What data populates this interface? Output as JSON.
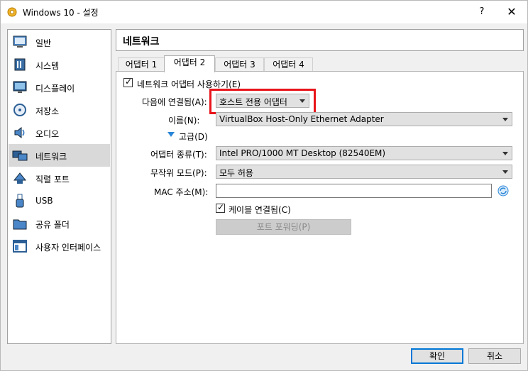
{
  "window": {
    "title": "Windows 10 - 설정",
    "help_label": "?",
    "close_label": "✕"
  },
  "sidebar": {
    "items": [
      {
        "label": "일반",
        "icon": "general-icon"
      },
      {
        "label": "시스템",
        "icon": "system-icon"
      },
      {
        "label": "디스플레이",
        "icon": "display-icon"
      },
      {
        "label": "저장소",
        "icon": "storage-icon"
      },
      {
        "label": "오디오",
        "icon": "audio-icon"
      },
      {
        "label": "네트워크",
        "icon": "network-icon",
        "selected": true
      },
      {
        "label": "직렬 포트",
        "icon": "serial-port-icon"
      },
      {
        "label": "USB",
        "icon": "usb-icon"
      },
      {
        "label": "공유 폴더",
        "icon": "shared-folder-icon"
      },
      {
        "label": "사용자 인터페이스",
        "icon": "user-interface-icon"
      }
    ]
  },
  "page": {
    "title": "네트워크"
  },
  "tabs": [
    {
      "label": "어댑터 1"
    },
    {
      "label": "어댑터 2",
      "active": true
    },
    {
      "label": "어댑터 3"
    },
    {
      "label": "어댑터 4"
    }
  ],
  "network": {
    "enable_label": "네트워크 어댑터 사용하기(E)",
    "enable_checked": true,
    "attached_label": "다음에 연결됨(A):",
    "attached_value": "호스트 전용 어댑터",
    "name_label": "이름(N):",
    "name_value": "VirtualBox Host-Only Ethernet Adapter",
    "advanced_label": "고급(D)",
    "adapter_type_label": "어댑터 종류(T):",
    "adapter_type_value": "Intel PRO/1000 MT Desktop (82540EM)",
    "promiscuous_label": "무작위 모드(P):",
    "promiscuous_value": "모두 허용",
    "mac_label": "MAC 주소(M):",
    "mac_value": "",
    "cable_label": "케이블 연결됨(C)",
    "cable_checked": true,
    "port_forwarding_label": "포트 포워딩(P)"
  },
  "footer": {
    "ok_label": "확인",
    "cancel_label": "취소"
  },
  "colors": {
    "highlight": "#e8141a",
    "accent": "#0078d7",
    "selected_bg": "#d9d9d9"
  }
}
